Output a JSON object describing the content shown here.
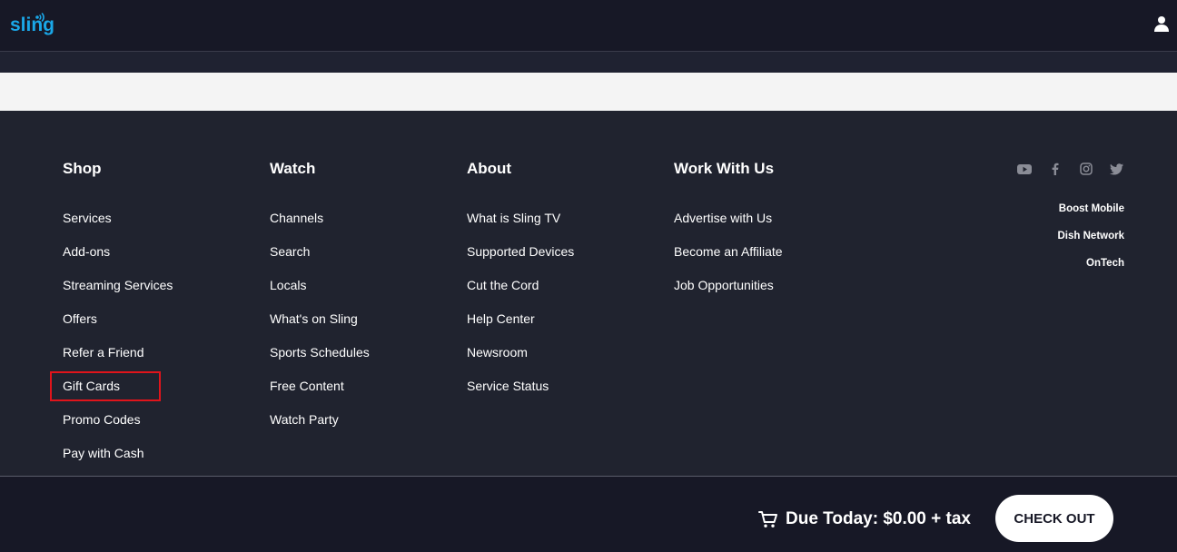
{
  "header": {
    "logo_text": "sling"
  },
  "footer": {
    "columns": [
      {
        "title": "Shop",
        "items": [
          "Services",
          "Add-ons",
          "Streaming Services",
          "Offers",
          "Refer a Friend",
          "Gift Cards",
          "Promo Codes",
          "Pay with Cash"
        ]
      },
      {
        "title": "Watch",
        "items": [
          "Channels",
          "Search",
          "Locals",
          "What's on Sling",
          "Sports Schedules",
          "Free Content",
          "Watch Party"
        ]
      },
      {
        "title": "About",
        "items": [
          "What is Sling TV",
          "Supported Devices",
          "Cut the Cord",
          "Help Center",
          "Newsroom",
          "Service Status"
        ]
      },
      {
        "title": "Work With Us",
        "items": [
          "Advertise with Us",
          "Become an Affiliate",
          "Job Opportunities"
        ]
      }
    ],
    "social": [
      "youtube-icon",
      "facebook-icon",
      "instagram-icon",
      "twitter-icon"
    ],
    "partners": [
      "Boost Mobile",
      "Dish Network",
      "OnTech"
    ]
  },
  "checkout": {
    "due_text": "Due Today: $0.00 + tax",
    "button_label": "CHECK OUT"
  },
  "colors": {
    "accent": "#1aa7e8",
    "highlight": "#e0141b",
    "footer_bg": "#20232f",
    "header_bg": "#171826"
  }
}
